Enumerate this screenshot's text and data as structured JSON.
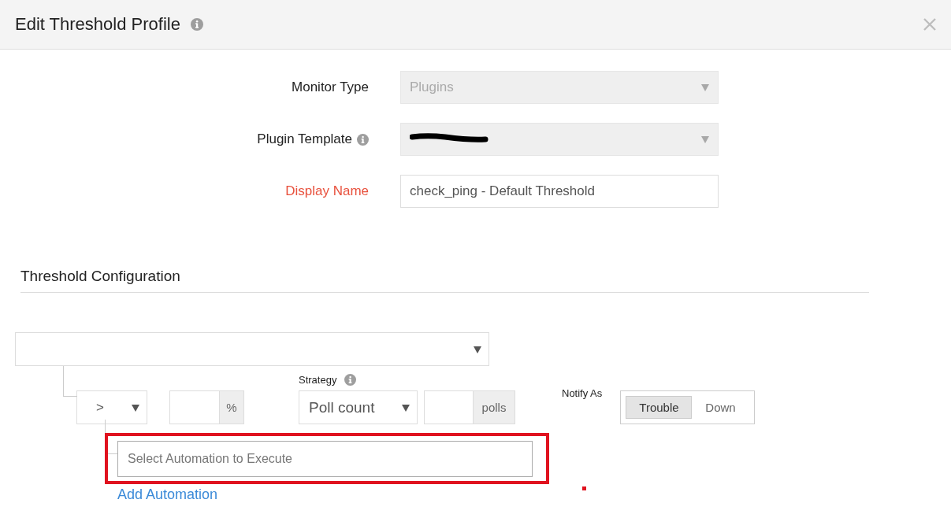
{
  "dialog": {
    "title": "Edit Threshold Profile",
    "has_info": true
  },
  "fields": [
    {
      "kind": "select",
      "label": "Monitor Type",
      "value": "Plugins",
      "disabled": true,
      "required": false,
      "has_info": false,
      "redacted": false
    },
    {
      "kind": "select",
      "label": "Plugin Template",
      "disabled": true,
      "required": false,
      "has_info": true,
      "redacted": true
    },
    {
      "kind": "text",
      "label": "Display Name",
      "value": "check_ping - Default Threshold",
      "disabled": false,
      "required": true,
      "has_info": false,
      "redacted": false
    }
  ],
  "threshold": {
    "title": "Threshold Configuration",
    "operator": ">",
    "value_unit": "%",
    "strategy_label": "Strategy",
    "strategy": "Poll count",
    "polls_unit": "polls",
    "notify_label": "Notify As",
    "notify_options": [
      {
        "label": "Trouble",
        "selected": true
      },
      {
        "label": "Down",
        "selected": false
      }
    ],
    "automation": {
      "placeholder": "Select Automation to Execute",
      "highlighted": true
    },
    "add_automation": "Add Automation"
  }
}
